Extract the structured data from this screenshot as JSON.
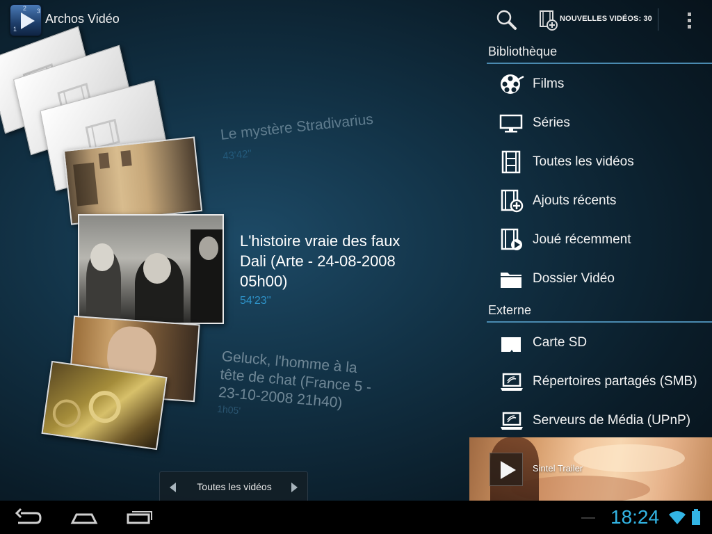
{
  "app": {
    "title": "Archos Vidéo",
    "icon_digits": [
      "2",
      "3",
      "1"
    ]
  },
  "action_bar": {
    "search_icon": "search-icon",
    "new_videos_label": "NOUVELLES VIDÉOS: 30",
    "overflow_icon": "overflow-menu-icon"
  },
  "library": {
    "header": "Bibliothèque",
    "items": [
      {
        "label": "Films",
        "icon": "film-reel-icon"
      },
      {
        "label": "Séries",
        "icon": "tv-icon"
      },
      {
        "label": "Toutes les vidéos",
        "icon": "film-strip-icon"
      },
      {
        "label": "Ajouts récents",
        "icon": "film-add-icon"
      },
      {
        "label": "Joué récemment",
        "icon": "film-play-icon"
      },
      {
        "label": "Dossier Vidéo",
        "icon": "folder-icon"
      }
    ]
  },
  "external": {
    "header": "Externe",
    "items": [
      {
        "label": "Carte SD",
        "icon": "sd-card-icon"
      },
      {
        "label": "Répertoires partagés (SMB)",
        "icon": "laptop-network-icon"
      },
      {
        "label": "Serveurs de Média (UPnP)",
        "icon": "laptop-network-icon"
      }
    ]
  },
  "trailer": {
    "label": "Sintel Trailer"
  },
  "cover_flow": {
    "items": [
      {
        "title": "Le mystère Stradivarius",
        "duration": "43'42''"
      },
      {
        "title_lines": [
          "L'histoire vraie des faux",
          "Dali (Arte - 24-08-2008",
          "05h00)"
        ],
        "duration": "54'23''"
      },
      {
        "title_lines": [
          "Geluck, l'homme à la",
          "tête de chat (France 5 -",
          "23-10-2008 21h40)"
        ],
        "duration": "1h05'"
      }
    ]
  },
  "selector": {
    "label": "Toutes les vidéos"
  },
  "system_bar": {
    "time": "18:24",
    "colors": {
      "clock": "#33b5e5",
      "accent": "#2e92c8"
    }
  }
}
